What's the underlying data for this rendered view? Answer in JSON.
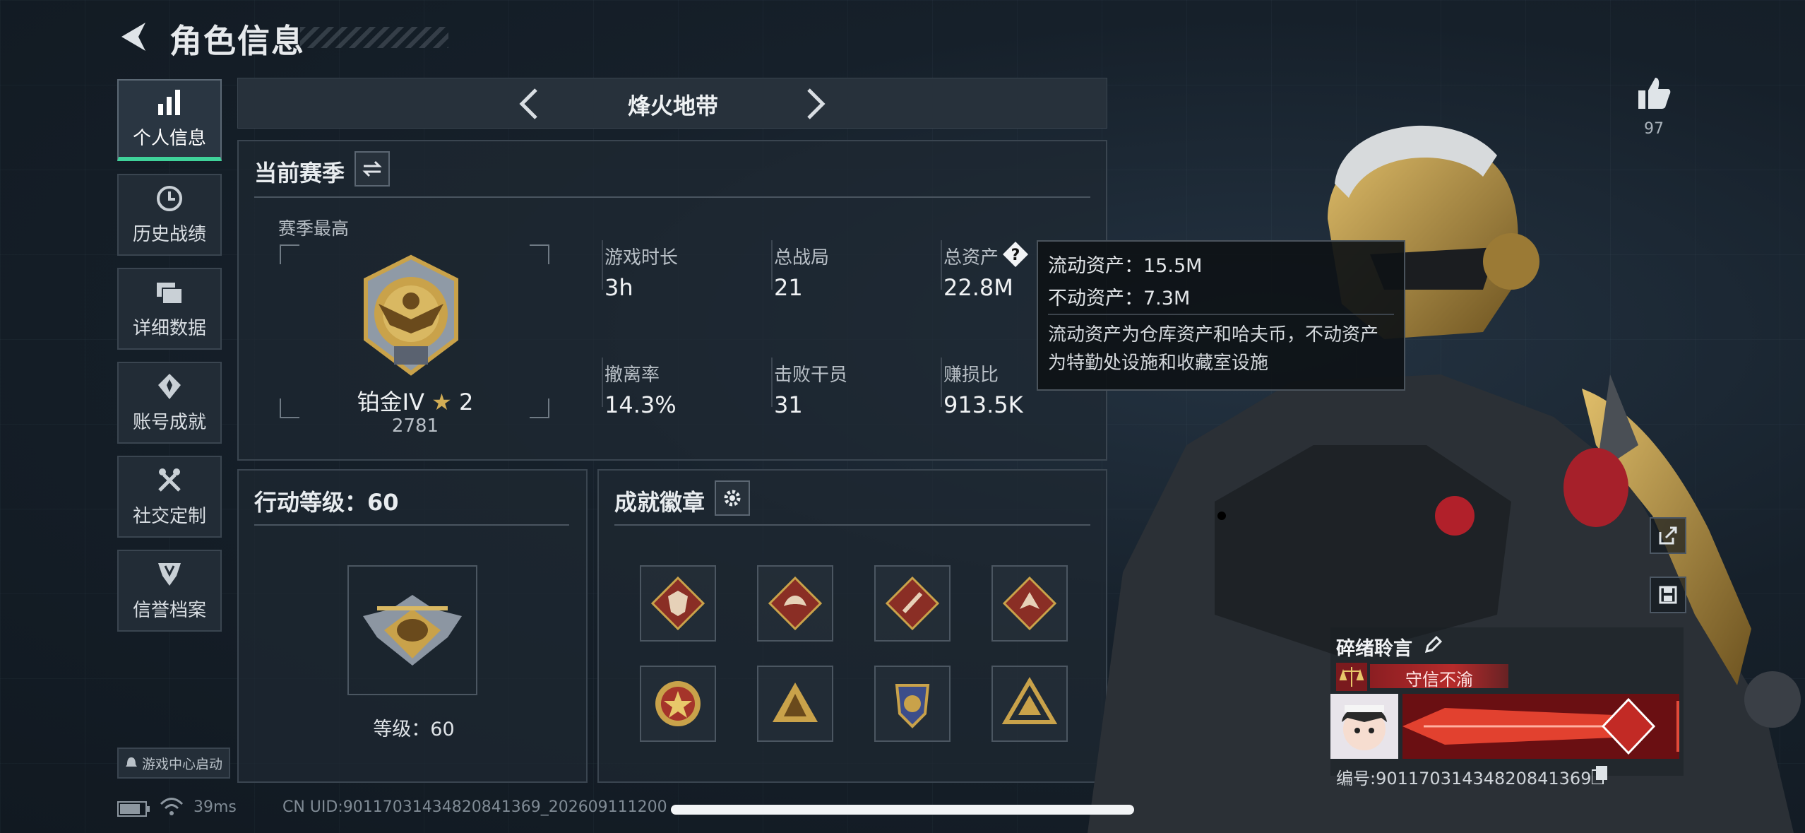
{
  "header": {
    "title": "角色信息"
  },
  "sidebar": {
    "items": [
      {
        "label": "个人信息",
        "icon": "bar-chart-icon",
        "active": true
      },
      {
        "label": "历史战绩",
        "icon": "clock-icon",
        "active": false
      },
      {
        "label": "详细数据",
        "icon": "folder-icon",
        "active": false
      },
      {
        "label": "账号成就",
        "icon": "medal-icon",
        "active": false
      },
      {
        "label": "社交定制",
        "icon": "tools-icon",
        "active": false
      },
      {
        "label": "信誉档案",
        "icon": "shield-icon",
        "active": false
      }
    ],
    "launch_label": "游戏中心启动"
  },
  "mode": {
    "title": "烽火地带"
  },
  "season": {
    "title": "当前赛季",
    "best_label": "赛季最高",
    "rank_name": "铂金IV",
    "rank_stars": "2",
    "rank_score": "2781",
    "stats": [
      {
        "label": "游戏时长",
        "value": "3h"
      },
      {
        "label": "总战局",
        "value": "21"
      },
      {
        "label": "总资产",
        "value": "22.8M"
      },
      {
        "label": "撤离率",
        "value": "14.3%"
      },
      {
        "label": "击败干员",
        "value": "31"
      },
      {
        "label": "赚损比",
        "value": "913.5K"
      }
    ]
  },
  "tooltip": {
    "line1": "流动资产：15.5M",
    "line2": "不动资产：7.3M",
    "desc": "流动资产为仓库资产和哈夫币，不动资产为特勤处设施和收藏室设施"
  },
  "action_level": {
    "title": "行动等级：60",
    "level_text": "等级：60"
  },
  "achievements": {
    "title": "成就徽章",
    "badges": [
      "wolf-badge-icon",
      "dragon-badge-icon",
      "knife-badge-icon",
      "eagle-badge-icon",
      "star-emblem-icon",
      "pyramid-badge-icon",
      "crest-badge-icon",
      "triangle-badge-icon"
    ]
  },
  "profile": {
    "like_count": "97",
    "name": "碎绪聆言",
    "motto": "守信不渝",
    "uid_label": "编号:9011703143482084136​9"
  },
  "footer": {
    "ping": "39ms",
    "uid": "CN UID:9011703143482084136​9_202609111200"
  },
  "colors": {
    "accent_green": "#3fd29a",
    "gold": "#c9a24a",
    "red": "#b62b2b"
  }
}
